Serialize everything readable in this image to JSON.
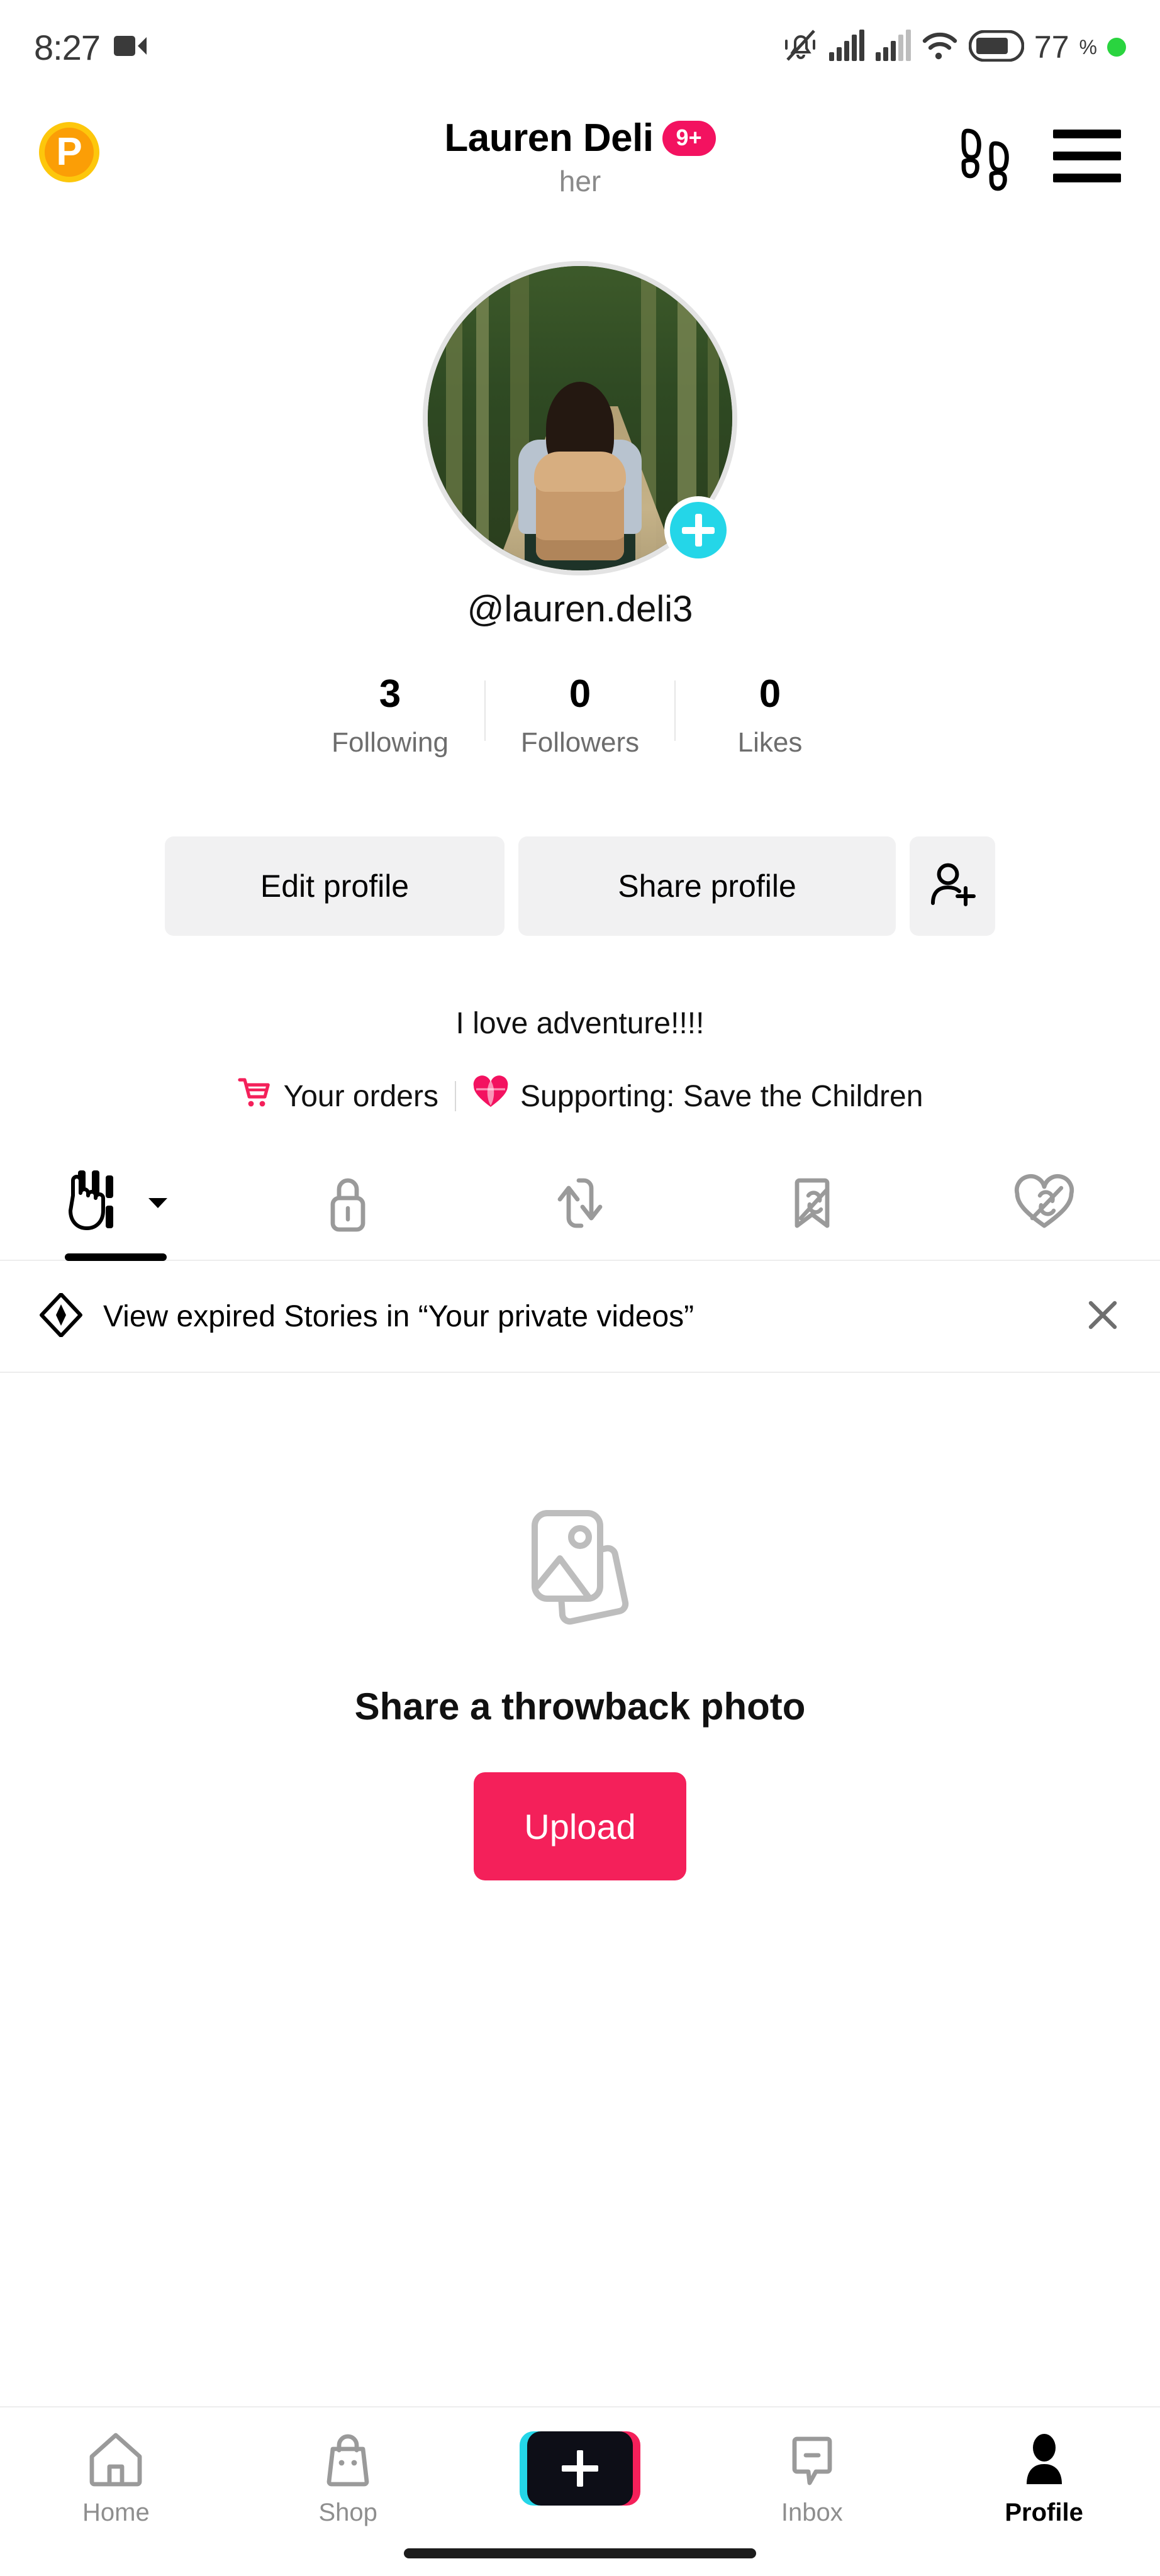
{
  "status_bar": {
    "time": "8:27",
    "recording_icon": "video-camera-icon",
    "silent_icon": "bell-muted-icon",
    "signal_1_icon": "cellular-signal-icon",
    "signal_2_icon": "cellular-signal-icon",
    "wifi_icon": "wifi-icon",
    "battery_icon": "battery-icon",
    "battery_level": "77",
    "battery_unit": "%",
    "green_dot": "privacy-indicator-dot"
  },
  "header": {
    "coin_label": "P",
    "title": "Lauren Deli",
    "badge": "9+",
    "pronouns": "her",
    "footsteps_icon": "footsteps-icon",
    "menu_icon": "hamburger-menu-icon"
  },
  "profile": {
    "avatar_alt": "hiker-with-backpack-in-forest",
    "add_story_icon": "plus-icon",
    "username": "@lauren.deli3",
    "stats": [
      {
        "value": "3",
        "label": "Following"
      },
      {
        "value": "0",
        "label": "Followers"
      },
      {
        "value": "0",
        "label": "Likes"
      }
    ],
    "edit_profile_label": "Edit profile",
    "share_profile_label": "Share profile",
    "add_friends_icon": "add-user-icon",
    "bio": "I love adventure!!!!",
    "orders_label": "Your orders",
    "orders_icon": "shopping-cart-icon",
    "supporting_label": "Supporting: Save the Children",
    "supporting_icon": "charity-heart-icon"
  },
  "tabs": [
    {
      "name": "posts",
      "icon": "grid-posts-icon",
      "active": true,
      "has_caret": true
    },
    {
      "name": "private",
      "icon": "lock-icon",
      "active": false
    },
    {
      "name": "reposts",
      "icon": "repost-loop-icon",
      "active": false
    },
    {
      "name": "saved",
      "icon": "bookmark-hidden-icon",
      "active": false
    },
    {
      "name": "liked",
      "icon": "heart-hidden-icon",
      "active": false
    }
  ],
  "banner": {
    "icon": "sparkle-circle-icon",
    "text": "View expired Stories in “Your private videos”",
    "close_icon": "close-icon"
  },
  "empty_state": {
    "icon": "photo-stack-icon",
    "title": "Share a throwback photo",
    "upload_label": "Upload"
  },
  "bottom_nav": [
    {
      "label": "Home",
      "icon": "home-icon",
      "active": false
    },
    {
      "label": "Shop",
      "icon": "shopping-bag-icon",
      "active": false
    },
    {
      "label": "",
      "icon": "create-plus-icon",
      "active": false
    },
    {
      "label": "Inbox",
      "icon": "message-icon",
      "active": false
    },
    {
      "label": "Profile",
      "icon": "person-icon",
      "active": true
    }
  ],
  "colors": {
    "accent_pink": "#f4205a",
    "badge_pink": "#f31260",
    "cyan": "#24d6e8",
    "coin_gold": "#fdc70c",
    "green": "#2ad43f"
  }
}
